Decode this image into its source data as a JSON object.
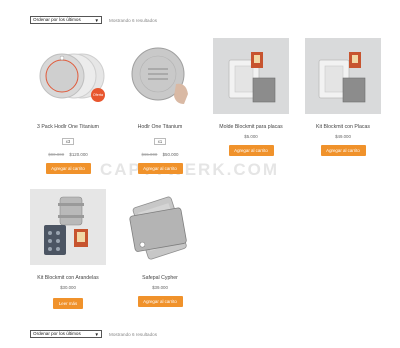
{
  "sorting": {
    "selected": "Ordenar por los últimos",
    "result_text": "Mostrando 6 resultados"
  },
  "products": [
    {
      "title": "3 Pack Hodlr One Titanium",
      "badge": "x3",
      "old_price": "$90.000",
      "price": "$120.000",
      "button": "Agregar al carrito",
      "sale": "Oferta"
    },
    {
      "title": "Hodlr One Titanium",
      "badge": "x1",
      "old_price": "$65.000",
      "price": "$50.000",
      "button": "Agregar al carrito"
    },
    {
      "title": "Molde Blockmit para placas",
      "price": "$5.000",
      "button": "Agregar al carrito"
    },
    {
      "title": "Kit Blockmit con Placas",
      "price": "$49.000",
      "button": "Agregar al carrito"
    },
    {
      "title": "Kit Blockmit con Arandelas",
      "price": "$30.000",
      "button": "Leer más"
    },
    {
      "title": "Safepal Cypher",
      "price": "$39.000",
      "button": "Agregar al carrito"
    }
  ],
  "watermark": "CAPTTWERK.COM",
  "colors": {
    "accent": "#f0922b",
    "sale": "#e8562e"
  }
}
